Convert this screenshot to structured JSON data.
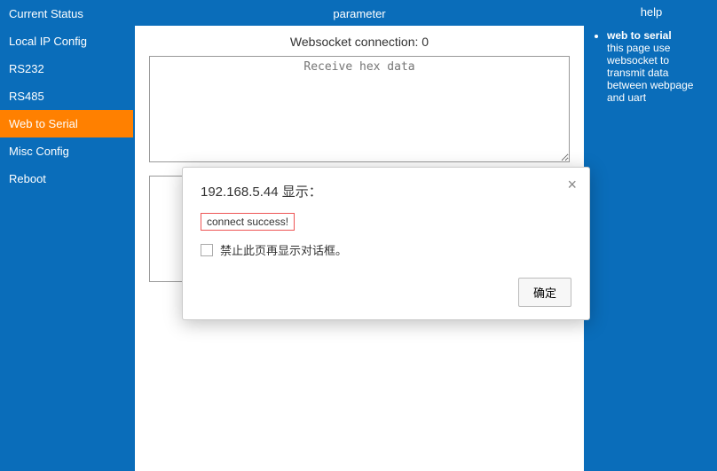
{
  "sidebar": {
    "items": [
      {
        "label": "Current Status",
        "active": false
      },
      {
        "label": "Local IP Config",
        "active": false
      },
      {
        "label": "RS232",
        "active": false
      },
      {
        "label": "RS485",
        "active": false
      },
      {
        "label": "Web to Serial",
        "active": true
      },
      {
        "label": "Misc Config",
        "active": false
      },
      {
        "label": "Reboot",
        "active": false
      }
    ]
  },
  "main": {
    "header": "parameter",
    "connection_label": "Websocket connection: 0",
    "receive_placeholder": "Receive hex data"
  },
  "help": {
    "header": "help",
    "title": "web to serial",
    "body": "this page use websocket to transmit data between webpage and uart"
  },
  "dialog": {
    "title": "192.168.5.44 显示：",
    "message": "connect success!",
    "checkbox_label": "禁止此页再显示对话框。",
    "ok_label": "确定"
  }
}
